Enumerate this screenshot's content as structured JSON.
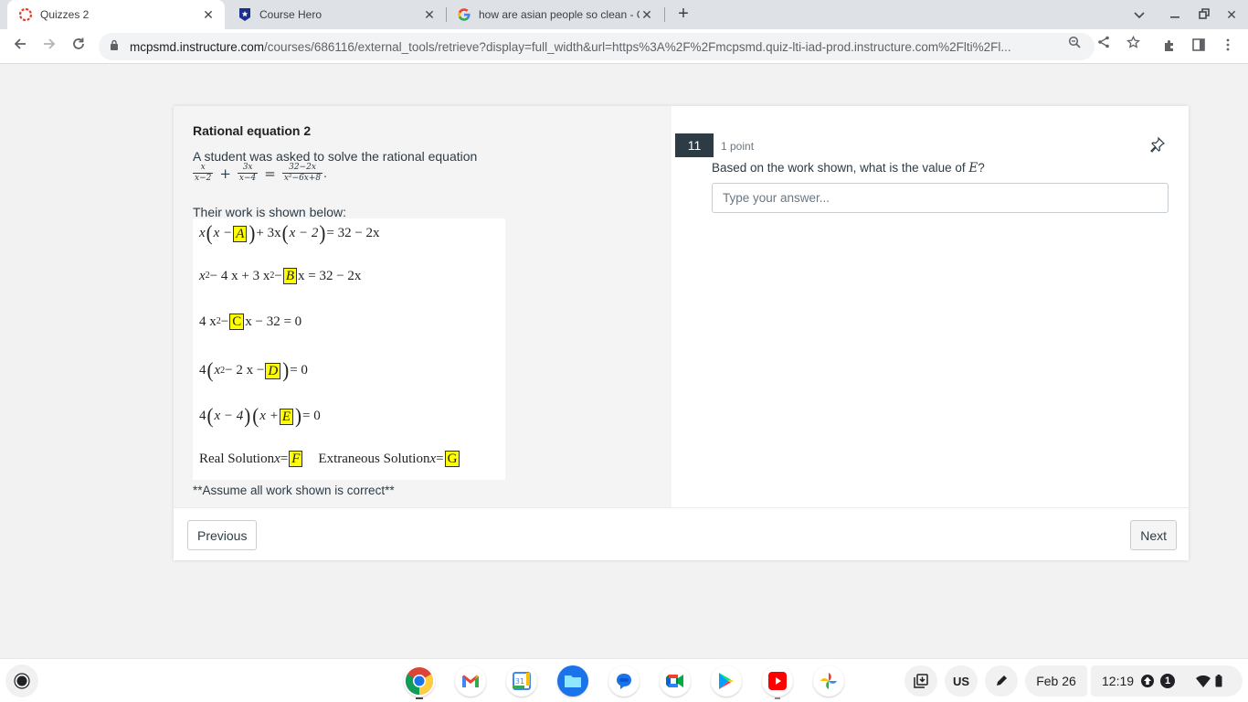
{
  "browser": {
    "tabs": [
      {
        "title": "Quizzes 2",
        "icon": "canvas-icon",
        "active": true
      },
      {
        "title": "Course Hero",
        "icon": "course-hero-icon",
        "active": false
      },
      {
        "title": "how are asian people so clean - G",
        "icon": "google-icon",
        "active": false
      }
    ],
    "new_tab_label": "+",
    "url_host": "mcpsmd.instructure.com",
    "url_path": "/courses/686116/external_tools/retrieve?display=full_width&url=https%3A%2F%2Fmcpsmd.quiz-lti-iad-prod.instructure.com%2Flti%2Fl..."
  },
  "stimulus": {
    "title": "Rational equation 2",
    "intro": "A student was asked to solve the rational equation",
    "equation": {
      "lhs1": {
        "num": "x",
        "den": "x−2"
      },
      "op1": "+",
      "lhs2": {
        "num": "3x",
        "den": "x−4"
      },
      "eq": "=",
      "rhs": {
        "num": "32−2x",
        "den": "x²−6x+8"
      },
      "end": "."
    },
    "work_label": "Their work is shown below:",
    "work_lines": {
      "l1": {
        "a": "x",
        "b": "x − ",
        "box": "A",
        "c": " + 3x",
        "d": "x − 2",
        "e": " = 32 − 2x"
      },
      "l2": {
        "a": "x",
        "sup": "2",
        "b": " − 4 x + 3 x",
        "sup2": "2",
        "c": " −",
        "box": "B",
        "d": "x = 32 − 2x"
      },
      "l3": {
        "a": "4 x",
        "sup": "2",
        "b": " −",
        "box": "C",
        "c": "x − 32 = 0"
      },
      "l4": {
        "a": "4",
        "b": "x",
        "sup": "2",
        "c": " − 2 x  −",
        "box": "D",
        "d": " = 0"
      },
      "l5": {
        "a": "4",
        "b": "x −  4",
        "c": "x +",
        "box": "E",
        "d": " = 0"
      },
      "l6": {
        "real": "Real Solution ",
        "x1": "x",
        "eq1": " = ",
        "box1": "F",
        "ext": "Extraneous  Solution ",
        "x2": "x",
        "eq2": " = ",
        "box2": "G"
      }
    },
    "note": "**Assume all work shown is correct**"
  },
  "question": {
    "number": "11",
    "points": "1 point",
    "text_before": "Based on the work shown, what is the value of ",
    "math_var": "E",
    "text_after": "?",
    "answer_placeholder": "Type your answer...",
    "answer_value": ""
  },
  "footer": {
    "previous_label": "Previous",
    "next_label": "Next"
  },
  "shelf": {
    "apps": [
      "Chrome",
      "Gmail",
      "Calendar",
      "Files",
      "Messages",
      "Meet",
      "Play Store",
      "YouTube",
      "Photos"
    ],
    "calendar_day": "31",
    "ime": "US",
    "date": "Feb 26",
    "time": "12:19",
    "notification_count": "1"
  },
  "colors": {
    "question_number_bg": "#2d3b45",
    "highlight": "#ffff00",
    "text": "#2d3b45"
  }
}
